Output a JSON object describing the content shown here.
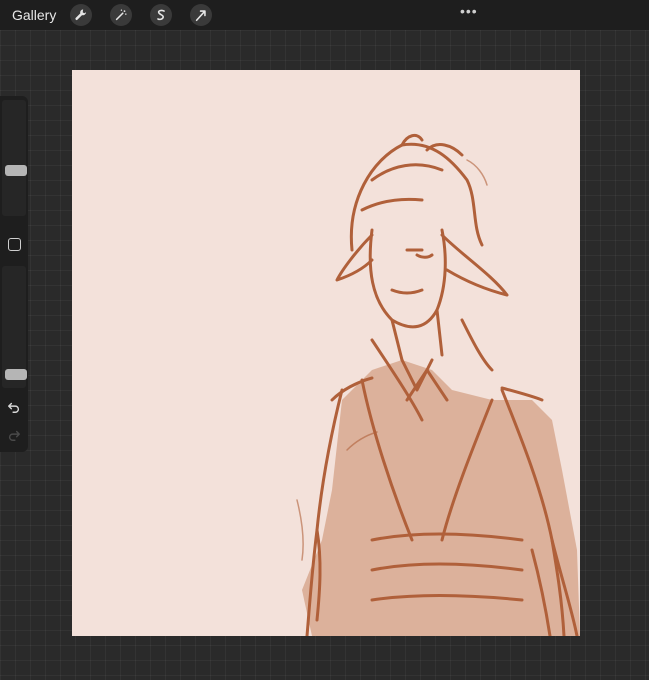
{
  "topbar": {
    "gallery_label": "Gallery",
    "tools": [
      {
        "icon": "wrench-icon"
      },
      {
        "icon": "magic-wand-icon"
      },
      {
        "icon": "selection-icon"
      },
      {
        "icon": "transform-arrow-icon"
      }
    ],
    "more_label": "•••"
  },
  "sidebar": {
    "brush_size_level": 0.37,
    "opacity_level": 0.05,
    "icons": [
      "undo-icon",
      "redo-icon"
    ]
  },
  "canvas": {
    "background_color": "#f3e1da",
    "ink_color": "#b0603a",
    "wash_color": "#c98a68"
  }
}
